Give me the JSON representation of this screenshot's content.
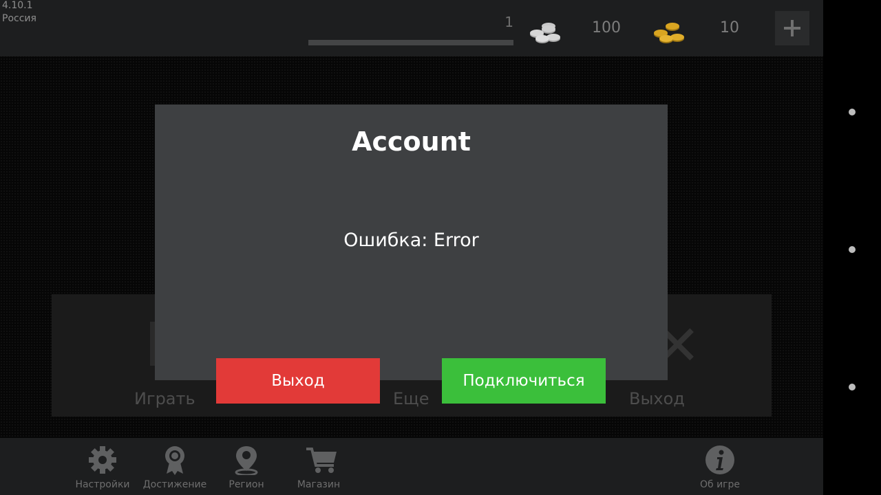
{
  "topbar": {
    "version": "4.10.1",
    "region": "Россия",
    "level": "1",
    "level_progress": 0.0,
    "silver_coins": "100",
    "gold_coins": "10",
    "add_icon": "plus-icon"
  },
  "menu": {
    "play_label": "Играть",
    "more_label": "Еще",
    "exit_label": "Выход"
  },
  "bottom_nav": {
    "items": [
      {
        "label": "Настройки",
        "icon": "gear-icon"
      },
      {
        "label": "Достижение",
        "icon": "award-icon"
      },
      {
        "label": "Регион",
        "icon": "map-pin-icon"
      },
      {
        "label": "Магазин",
        "icon": "cart-icon"
      },
      {
        "label": "Об игре",
        "icon": "info-icon"
      }
    ]
  },
  "dialog": {
    "title": "Account",
    "message": "Ошибка: Error",
    "exit_button": "Выход",
    "connect_button": "Подключиться"
  },
  "colors": {
    "dialog_bg": "#3e4042",
    "exit_button": "#e23a38",
    "connect_button": "#3bbf3b",
    "bars": "#1d1e1f",
    "gold": "#d9a521",
    "silver": "#c8c8c8"
  }
}
